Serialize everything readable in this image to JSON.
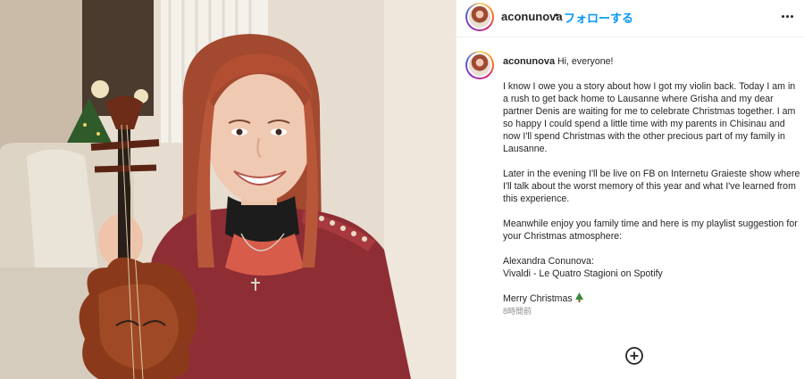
{
  "post": {
    "image_alt": "Woman in a red sweater smiling and holding a violin in front of a Christmas tree"
  },
  "header": {
    "username": "aconunova",
    "separator": "•",
    "follow_label": "フォローする",
    "more_icon": "more-horizontal-icon"
  },
  "caption": {
    "username": "aconunova",
    "greeting": " Hi, everyone!",
    "paragraphs": [
      "I know I owe you a story about how I got my violin back. Today I am in a rush to get back home to Lausanne where Grisha and my dear partner Denis are waiting for me to celebrate Christmas together. I am so happy I could spend a little time with my parents in Chisinau and now I'll spend Christmas with the other precious part of my family in Lausanne.",
      "Later in the evening I'll be live on FB on Internetu Graieste show where I'll talk about the worst memory of this year and what I've learned from this experience.",
      "Meanwhile enjoy you family time and here is my playlist suggestion for your Christmas atmosphere:"
    ],
    "playlist_line1": "Alexandra Conunova:",
    "playlist_line2": "Vivaldi - Le Quatro Stagioni on Spotify",
    "closing": "Merry Christmas ",
    "closing_emoji": "christmas-tree-icon",
    "timestamp": "8時間前"
  },
  "footer": {
    "add_icon": "add-circle-icon"
  }
}
